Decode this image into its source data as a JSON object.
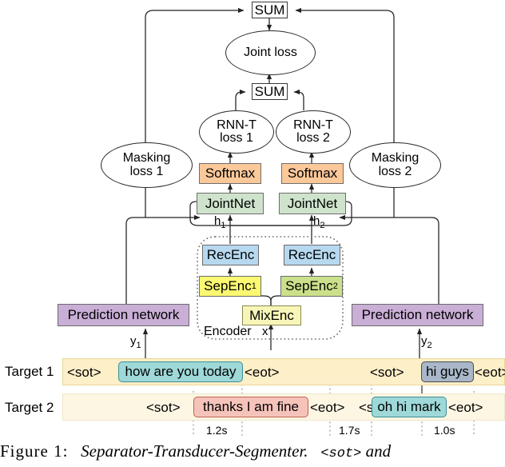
{
  "diagram": {
    "title": "Separator-Transducer-Segmenter",
    "nodes": {
      "sum_top": "SUM",
      "joint_loss": "Joint loss",
      "sum_mid": "SUM",
      "rnnt_loss_1": "RNN-T\nloss 1",
      "rnnt_loss_1_line1": "RNN-T",
      "rnnt_loss_1_line2": "loss 1",
      "rnnt_loss_2_line1": "RNN-T",
      "rnnt_loss_2_line2": "loss 2",
      "masking_loss_1_line1": "Masking",
      "masking_loss_1_line2": "loss 1",
      "masking_loss_2_line1": "Masking",
      "masking_loss_2_line2": "loss 2",
      "softmax_1": "Softmax",
      "softmax_2": "Softmax",
      "jointnet_1": "JointNet",
      "jointnet_2": "JointNet",
      "recenc_1": "RecEnc",
      "recenc_2": "RecEnc",
      "sepenc_1": "SepEnc",
      "sepenc_1_sub": "1",
      "sepenc_2": "SepEnc",
      "sepenc_2_sub": "2",
      "mixenc": "MixEnc",
      "encoder_label": "Encoder",
      "prediction_network_1": "Prediction network",
      "prediction_network_2": "Prediction network"
    },
    "edge_labels": {
      "h1": "h",
      "h1_sub": "1",
      "h2": "h",
      "h2_sub": "2",
      "y1": "y",
      "y1_sub": "1",
      "y2": "y",
      "y2_sub": "2",
      "x": "x"
    },
    "colors": {
      "softmax": "#fbc89a",
      "jointnet": "#cfe3cc",
      "recenc": "#b6d9ef",
      "sepenc1": "#fbf871",
      "sepenc2": "#cbe08a",
      "mixenc": "#f7f5b8",
      "prediction_network": "#c9aed6",
      "target1_row": "#fdefc8",
      "target2_row": "#fcf6e3",
      "chip_teal": "#9ed8d8",
      "chip_gray": "#a9b7c9",
      "chip_pink": "#f6c3bb"
    }
  },
  "targets": {
    "row1_label": "Target 1",
    "row2_label": "Target 2",
    "row1": {
      "sot_1": "<sot>",
      "chip_1": "how are you today",
      "eot_1": "<eot>",
      "sot_2": "<sot>",
      "chip_2": "hi guys",
      "eot_2": "<eot>"
    },
    "row2": {
      "sot_1": "<sot>",
      "chip_1": "thanks I am fine",
      "eot_1": "<eot>",
      "sot_2": "<sot>",
      "chip_2": "oh hi mark",
      "eot_2": "<eot>"
    },
    "durations": [
      "1.2s",
      "1.7s",
      "1.0s"
    ]
  },
  "caption": {
    "figure_number": "Figure  1:",
    "title": "Separator-Transducer-Segmenter.",
    "token": "<sot>",
    "trailing": "and"
  }
}
